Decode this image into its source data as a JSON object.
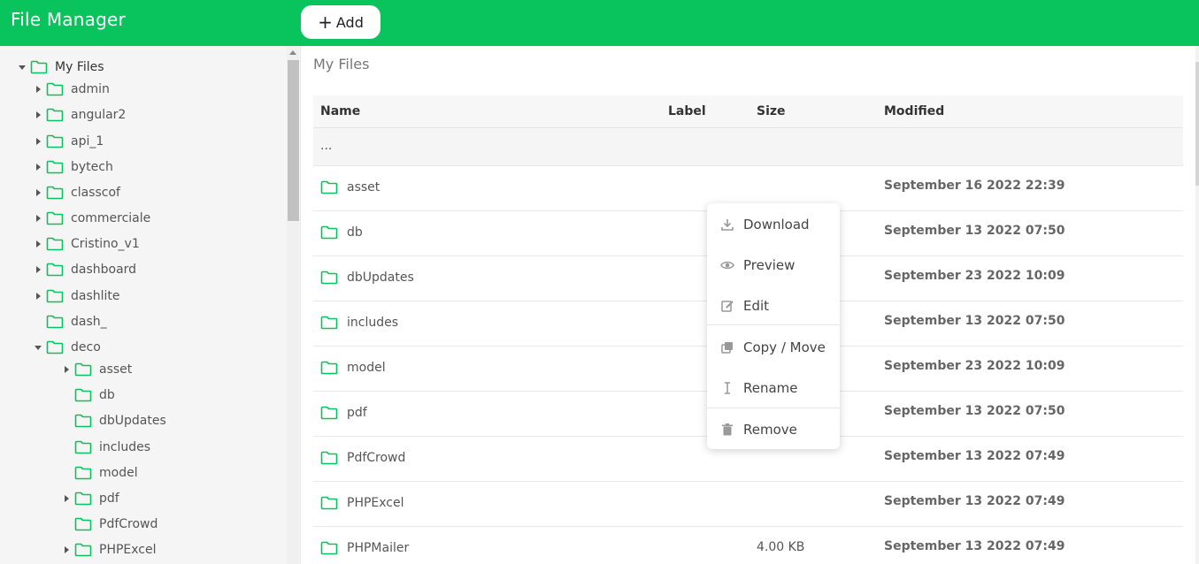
{
  "app": {
    "title": "File Manager"
  },
  "toolbar": {
    "add_label": "Add",
    "add_icon": "plus-icon"
  },
  "breadcrumb": {
    "text": "My Files"
  },
  "colors": {
    "brand": "#09c35c",
    "folder": "#09c35c"
  },
  "tree": {
    "items": [
      {
        "label": "My Files",
        "caret": "down"
      },
      {
        "label": "admin",
        "caret": "right"
      },
      {
        "label": "angular2",
        "caret": "right"
      },
      {
        "label": "api_1",
        "caret": "right"
      },
      {
        "label": "bytech",
        "caret": "right"
      },
      {
        "label": "classcof",
        "caret": "right"
      },
      {
        "label": "commerciale",
        "caret": "right"
      },
      {
        "label": "Cristino_v1",
        "caret": "right"
      },
      {
        "label": "dashboard",
        "caret": "right"
      },
      {
        "label": "dashlite",
        "caret": "right"
      },
      {
        "label": "dash_",
        "caret": "none"
      },
      {
        "label": "deco",
        "caret": "down"
      },
      {
        "label": "asset",
        "caret": "right"
      },
      {
        "label": "db",
        "caret": "none"
      },
      {
        "label": "dbUpdates",
        "caret": "none"
      },
      {
        "label": "includes",
        "caret": "none"
      },
      {
        "label": "model",
        "caret": "none"
      },
      {
        "label": "pdf",
        "caret": "right"
      },
      {
        "label": "PdfCrowd",
        "caret": "none"
      },
      {
        "label": "PHPExcel",
        "caret": "right"
      }
    ]
  },
  "table": {
    "columns": {
      "name": "Name",
      "label": "Label",
      "size": "Size",
      "modified": "Modified"
    },
    "up_row": "...",
    "rows": [
      {
        "name": "asset",
        "size": "",
        "modified": "September 16 2022 22:39"
      },
      {
        "name": "db",
        "size": "",
        "modified": "September 13 2022 07:50"
      },
      {
        "name": "dbUpdates",
        "size": "",
        "modified": "September 23 2022 10:09"
      },
      {
        "name": "includes",
        "size": "",
        "modified": "September 13 2022 07:50"
      },
      {
        "name": "model",
        "size": "",
        "modified": "September 23 2022 10:09"
      },
      {
        "name": "pdf",
        "size": "",
        "modified": "September 13 2022 07:50"
      },
      {
        "name": "PdfCrowd",
        "size": "",
        "modified": "September 13 2022 07:49"
      },
      {
        "name": "PHPExcel",
        "size": "",
        "modified": "September 13 2022 07:49"
      },
      {
        "name": "PHPMailer",
        "size": "4.00 KB",
        "modified": "September 13 2022 07:49"
      }
    ]
  },
  "context_menu": {
    "items": [
      {
        "label": "Download",
        "icon": "download-icon"
      },
      {
        "label": "Preview",
        "icon": "eye-icon"
      },
      {
        "label": "Edit",
        "icon": "edit-icon"
      },
      {
        "label": "Copy / Move",
        "icon": "copy-icon"
      },
      {
        "label": "Rename",
        "icon": "text-cursor-icon"
      },
      {
        "label": "Remove",
        "icon": "trash-icon"
      }
    ]
  }
}
